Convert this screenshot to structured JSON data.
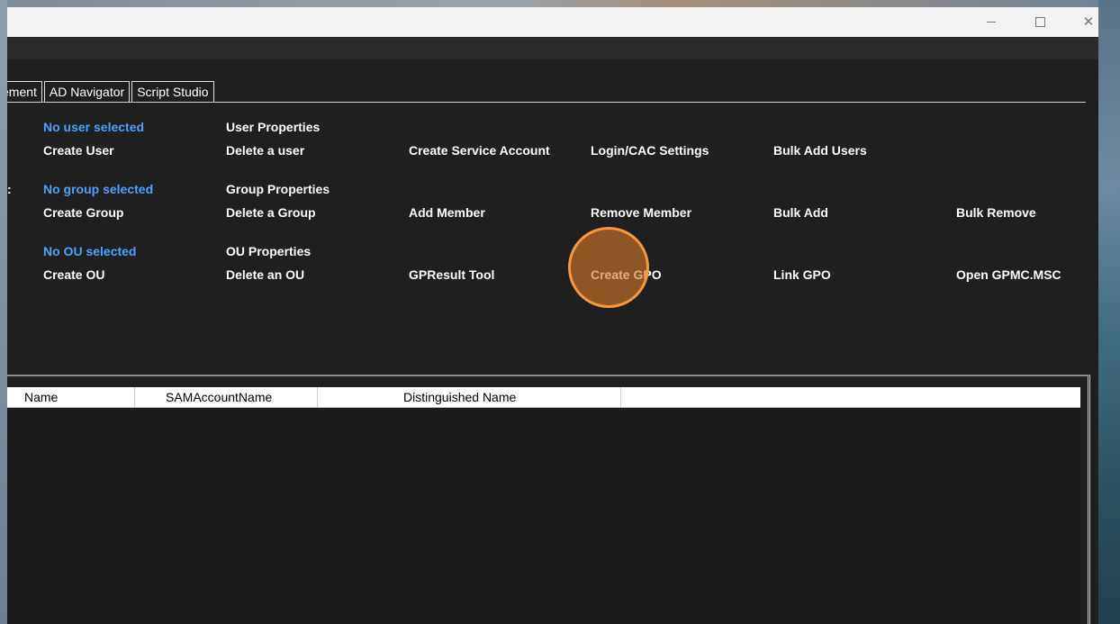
{
  "window": {
    "controls": {
      "minimize": "—",
      "maximize": "☐",
      "close": "✕"
    }
  },
  "tabs": [
    {
      "label": "ement"
    },
    {
      "label": "AD Navigator"
    },
    {
      "label": "Script Studio"
    }
  ],
  "user_section": {
    "status": "No user selected",
    "properties": "User Properties",
    "actions": [
      "Create User",
      "Delete a user",
      "Create Service Account",
      "Login/CAC Settings",
      "Bulk Add Users"
    ]
  },
  "group_section": {
    "colon": ":",
    "status": "No group selected",
    "properties": "Group Properties",
    "actions": [
      "Create Group",
      "Delete a Group",
      "Add Member",
      "Remove Member",
      "Bulk Add",
      "Bulk Remove"
    ]
  },
  "ou_section": {
    "status": "No OU selected",
    "properties": "OU Properties",
    "actions": [
      "Create OU",
      "Delete an OU",
      "GPResult Tool",
      "Create GPO",
      "Link GPO",
      "Open GPMC.MSC"
    ]
  },
  "grid": {
    "columns": [
      "Name",
      "SAMAccountName",
      "Distinguished Name",
      ""
    ]
  },
  "colors": {
    "status_blue": "#4aa3ff",
    "click_marker": "#f59a3c",
    "background": "#1f1f1f"
  }
}
